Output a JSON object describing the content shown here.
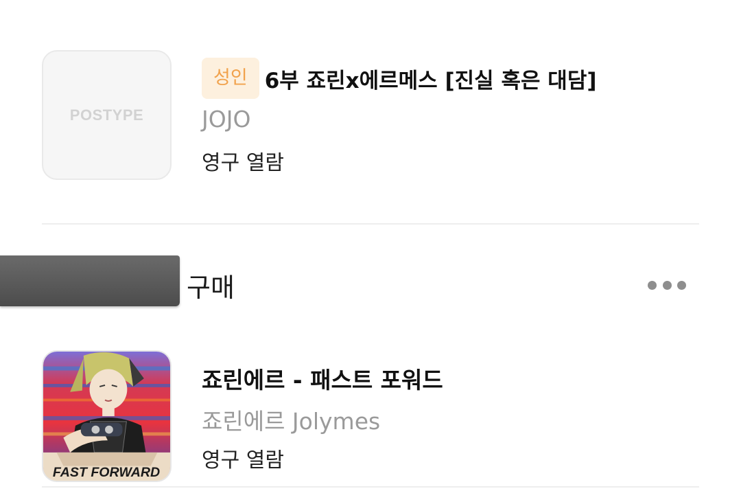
{
  "items": [
    {
      "thumbnail_text": "POSTYPE",
      "badge": "성인",
      "title": "6부 죠린x에르메스 [진실 혹은 대담]",
      "author": "JOJO",
      "status": "영구 열람"
    },
    {
      "thumbnail_text": "FAST FORWARD",
      "title": "죠린에르 - 패스트 포워드",
      "author": "죠린에르 Jolymes",
      "status": "영구 열람"
    }
  ],
  "section": {
    "label": "구매",
    "more_icon": "more-horizontal-icon"
  },
  "colors": {
    "badge_bg": "#fdf0de",
    "badge_text": "#f1a24c",
    "muted_text": "#9a9a9a"
  }
}
